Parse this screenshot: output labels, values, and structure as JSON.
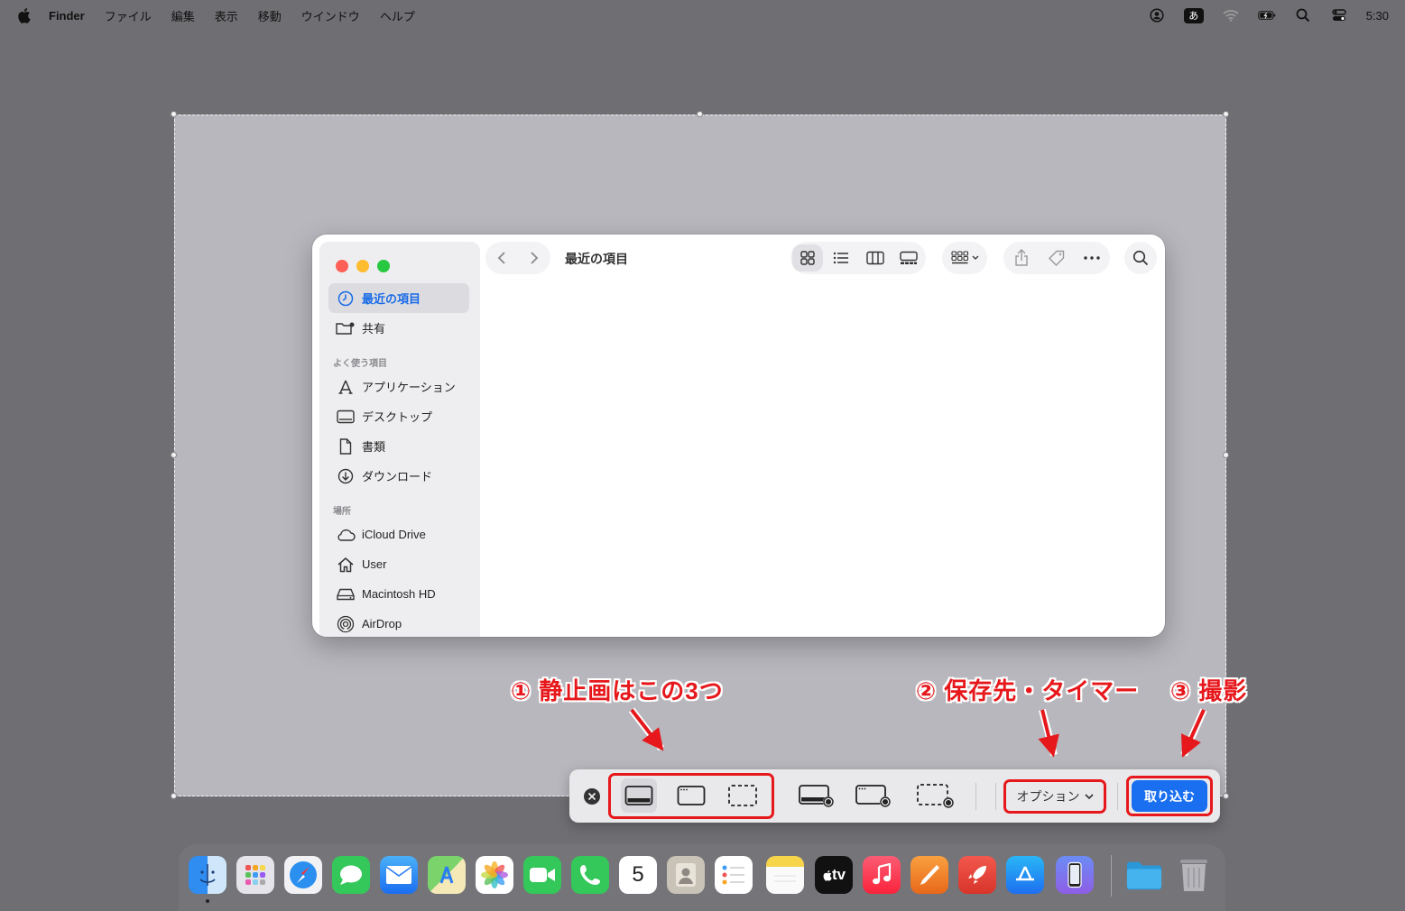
{
  "menubar": {
    "app_name": "Finder",
    "items": [
      "ファイル",
      "編集",
      "表示",
      "移動",
      "ウインドウ",
      "ヘルプ"
    ],
    "input_mode": "あ",
    "clock": "5:30"
  },
  "finder": {
    "title": "最近の項目",
    "sidebar": {
      "top_items": [
        {
          "label": "最近の項目",
          "icon": "clock-icon",
          "active": true
        },
        {
          "label": "共有",
          "icon": "shared-folder-icon",
          "active": false
        }
      ],
      "favorites_header": "よく使う項目",
      "favorites": [
        {
          "label": "アプリケーション",
          "icon": "applications-icon"
        },
        {
          "label": "デスクトップ",
          "icon": "desktop-icon"
        },
        {
          "label": "書類",
          "icon": "document-icon"
        },
        {
          "label": "ダウンロード",
          "icon": "download-icon"
        }
      ],
      "locations_header": "場所",
      "locations": [
        {
          "label": "iCloud Drive",
          "icon": "cloud-icon"
        },
        {
          "label": "User",
          "icon": "home-icon"
        },
        {
          "label": "Macintosh HD",
          "icon": "disk-icon"
        },
        {
          "label": "AirDrop",
          "icon": "airdrop-icon"
        }
      ]
    }
  },
  "annotations": {
    "callout_1": "① 静止画はこの3つ",
    "callout_2": "② 保存先・タイマー",
    "callout_3": "③ 撮影"
  },
  "capture_toolbar": {
    "options_label": "オプション",
    "capture_label": "取り込む"
  },
  "dock": {
    "calendar_day": "5",
    "tv_label": "tv",
    "apps": [
      "Finder",
      "Launchpad",
      "Safari",
      "Messages",
      "Mail",
      "Maps",
      "Photos",
      "FaceTime",
      "Phone",
      "Calendar",
      "Contacts",
      "Reminders",
      "Notes",
      "TV",
      "Music",
      "Pages",
      "Rocket",
      "App Store",
      "iPhone Mirroring",
      "Folder",
      "Trash"
    ]
  },
  "colors": {
    "accent_red": "#e6181c",
    "capture_blue": "#1a6ff0",
    "sidebar_active": "#1a6be8"
  }
}
